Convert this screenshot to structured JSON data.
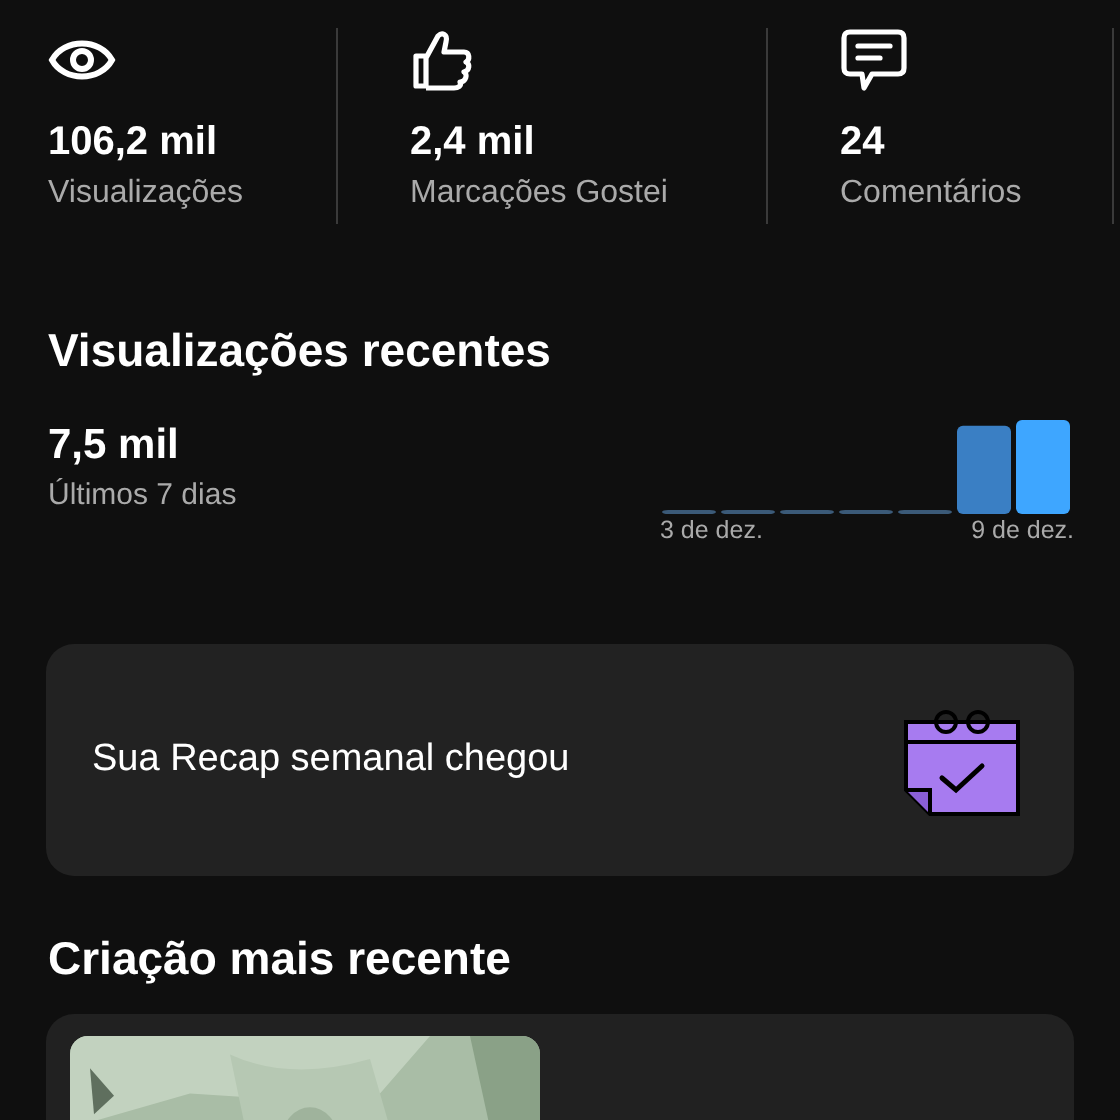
{
  "stats": [
    {
      "kind": "views",
      "value": "106,2 mil",
      "label": "Visualizações"
    },
    {
      "kind": "likes",
      "value": "2,4 mil",
      "label": "Marcações Gostei"
    },
    {
      "kind": "comments",
      "value": "24",
      "label": "Comentários"
    }
  ],
  "recent_views": {
    "title": "Visualizações recentes",
    "total": "7,5 mil",
    "period": "Últimos 7 dias",
    "start_label": "3 de dez.",
    "end_label": "9 de dez."
  },
  "recap_card": {
    "text": "Sua Recap semanal chegou"
  },
  "latest": {
    "title": "Criação mais recente"
  }
}
